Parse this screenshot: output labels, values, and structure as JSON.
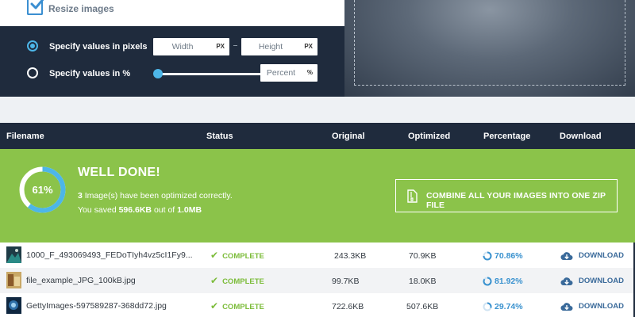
{
  "resize": {
    "label": "Resize images",
    "checked": true
  },
  "options": {
    "pixels_label": "Specify values in pixels",
    "percent_label": "Specify values in %",
    "width_placeholder": "Width",
    "height_placeholder": "Height",
    "percent_placeholder": "Percent",
    "px_unit": "PX",
    "pct_unit": "%",
    "selected": "pixels"
  },
  "table": {
    "headers": {
      "filename": "Filename",
      "status": "Status",
      "original": "Original",
      "optimized": "Optimized",
      "percentage": "Percentage",
      "download": "Download"
    }
  },
  "summary": {
    "percent": 61,
    "percent_label": "61%",
    "title": "WELL DONE!",
    "count": "3",
    "count_suffix": " Image(s) have been optimized correctly.",
    "saved_prefix": "You saved ",
    "saved": "596.6KB",
    "saved_mid": " out of ",
    "total": "1.0MB",
    "zip_label": "COMBINE ALL YOUR IMAGES INTO ONE ZIP FILE"
  },
  "files": [
    {
      "name": "1000_F_493069493_FEDoTIyh4vz5cI1Fy9...",
      "status": "COMPLETE",
      "original": "243.3KB",
      "optimized": "70.9KB",
      "percentage": "70.86%",
      "download": "DOWNLOAD"
    },
    {
      "name": "file_example_JPG_100kB.jpg",
      "status": "COMPLETE",
      "original": "99.7KB",
      "optimized": "18.0KB",
      "percentage": "81.92%",
      "download": "DOWNLOAD"
    },
    {
      "name": "GettyImages-597589287-368dd72.jpg",
      "status": "COMPLETE",
      "original": "722.6KB",
      "optimized": "507.6KB",
      "percentage": "29.74%",
      "download": "DOWNLOAD"
    }
  ],
  "colors": {
    "navy": "#1f2b3d",
    "accent_blue": "#4db6e8",
    "success_green": "#8bc34a",
    "status_green": "#7cbc3a",
    "link_blue": "#3a92cf"
  }
}
